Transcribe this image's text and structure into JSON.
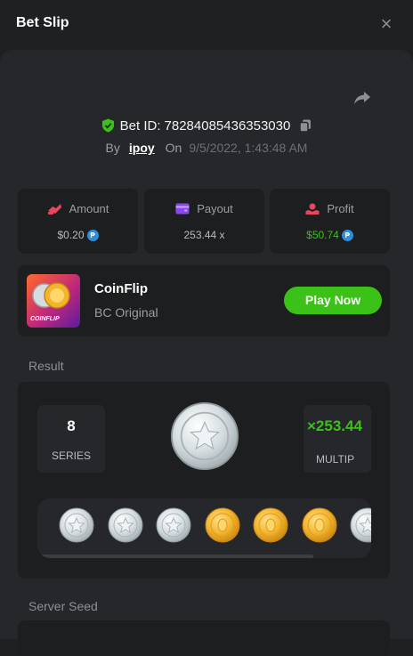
{
  "header": {
    "title": "Bet Slip",
    "close_symbol": "×"
  },
  "bet": {
    "id_label": "Bet ID:",
    "id": "78284085436353030",
    "by_label": "By",
    "user": "ipoy",
    "on_label": "On",
    "date": "9/5/2022, 1:43:48 AM"
  },
  "stats": {
    "amount": {
      "label": "Amount",
      "value": "$0.20"
    },
    "payout": {
      "label": "Payout",
      "value": "253.44 x"
    },
    "profit": {
      "label": "Profit",
      "value": "$50.74"
    }
  },
  "game": {
    "name": "CoinFlip",
    "subtitle": "BC Original",
    "thumb_text": "COINFLIP",
    "play_label": "Play Now"
  },
  "result": {
    "section_label": "Result",
    "series_value": "8",
    "series_label": "SERIES",
    "multiplier_value": "×253.44",
    "multiplier_label": "MULTIP",
    "coins": [
      "silver",
      "silver",
      "silver",
      "gold",
      "gold",
      "gold",
      "silver"
    ]
  },
  "server_seed": {
    "section_label": "Server Seed"
  },
  "colors": {
    "accent_green": "#3bc117",
    "coin_gold": "#f2b52e",
    "coin_silver": "#d5dde0",
    "currency_blue": "#2e8fd8"
  }
}
